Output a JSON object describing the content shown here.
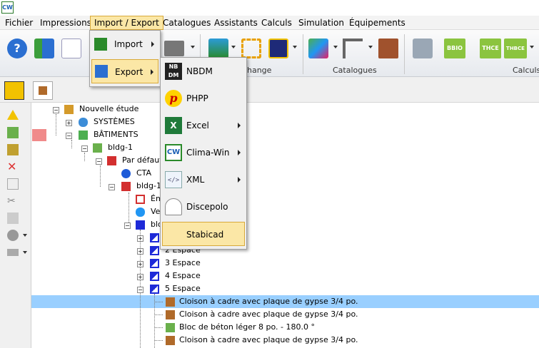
{
  "app": {
    "logo_text": "CW"
  },
  "menubar": [
    "Fichier",
    "Impressions",
    "Import / Export",
    "Catalogues",
    "Assistants",
    "Calculs",
    "Simulation",
    "Équipements"
  ],
  "toolbar": {
    "groups": [
      "hange",
      "Catalogues",
      "Calculs"
    ],
    "word_buttons": [
      "BBIO",
      "THCE",
      "THBCE"
    ]
  },
  "import_export_menu": [
    "Import",
    "Export"
  ],
  "export_submenu": [
    "NBDM",
    "PHPP",
    "Excel",
    "Clima-Win",
    "XML",
    "Discepolo",
    "Stabicad"
  ],
  "tree": [
    "Nouvelle étude",
    "SYSTÈMES",
    "BÂTIMENTS",
    "bldg-1",
    "Par défaut",
    "CTA",
    "bldg-1",
    "Ém",
    "Ve",
    "bloc",
    "2 Espace",
    "3 Espace",
    "4 Espace",
    "5 Espace",
    "Cloison à cadre avec plaque de gypse 3/4 po.",
    "Cloison à cadre avec plaque de gypse 3/4 po.",
    "Bloc de béton léger 8 po. - 180.0 °",
    "Cloison à cadre avec plaque de gypse 3/4 po."
  ],
  "colors": {
    "menu_highlight": "#fbe7a6",
    "selection": "#99cfff"
  }
}
